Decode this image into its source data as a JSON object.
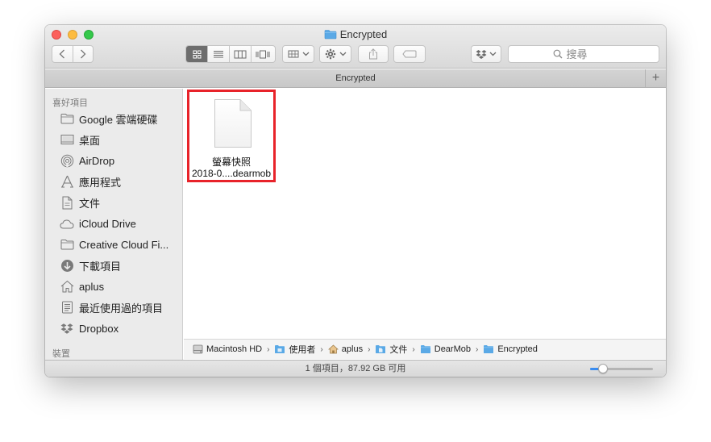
{
  "window": {
    "title": "Encrypted"
  },
  "toolbar": {
    "search_placeholder": "搜尋",
    "view_modes": [
      "icon-view",
      "list-view",
      "column-view",
      "cover-flow-view"
    ]
  },
  "tabbar": {
    "title": "Encrypted",
    "add_tab": "+"
  },
  "sidebar": {
    "favorites_header": "喜好項目",
    "items": [
      {
        "label": "Google 雲端硬碟",
        "icon": "folder-icon"
      },
      {
        "label": "桌面",
        "icon": "desktop-icon"
      },
      {
        "label": "AirDrop",
        "icon": "airdrop-icon"
      },
      {
        "label": "應用程式",
        "icon": "applications-icon"
      },
      {
        "label": "文件",
        "icon": "documents-icon"
      },
      {
        "label": "iCloud Drive",
        "icon": "cloud-icon"
      },
      {
        "label": "Creative Cloud Fi...",
        "icon": "folder-icon"
      },
      {
        "label": "下載項目",
        "icon": "downloads-icon"
      },
      {
        "label": "aplus",
        "icon": "home-icon"
      },
      {
        "label": "最近使用過的項目",
        "icon": "recents-icon"
      },
      {
        "label": "Dropbox",
        "icon": "dropbox-icon"
      }
    ],
    "devices_header": "裝置"
  },
  "content": {
    "files": [
      {
        "name_line1": "螢幕快照",
        "name_line2": "2018-0....dearmob",
        "icon": "document-icon"
      }
    ]
  },
  "pathbar": {
    "crumbs": [
      {
        "label": "Macintosh HD",
        "icon": "harddisk-icon"
      },
      {
        "label": "使用者",
        "icon": "folder-icon"
      },
      {
        "label": "aplus",
        "icon": "home-icon"
      },
      {
        "label": "文件",
        "icon": "folder-icon"
      },
      {
        "label": "DearMob",
        "icon": "folder-icon"
      },
      {
        "label": "Encrypted",
        "icon": "folder-icon"
      }
    ],
    "separator": "›"
  },
  "statusbar": {
    "text": "1 個項目，87.92 GB 可用"
  },
  "colors": {
    "selection_border": "#e8232a",
    "folder_blue": "#5aa9e6",
    "accent": "#3a8cf0"
  },
  "icon_size_slider": {
    "level": 0.2
  }
}
